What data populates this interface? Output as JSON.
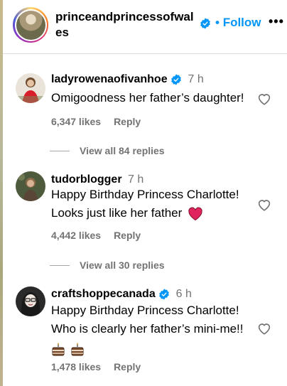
{
  "header": {
    "username": "princeandprincessofwales",
    "follow_label": "Follow",
    "more_label": "•••"
  },
  "comments": [
    {
      "username": "ladyrowenaofivanhoe",
      "time": "7 h",
      "text": "Omigoodness her father’s daughter!",
      "likes": "6,347 likes",
      "reply_label": "Reply",
      "view_replies": "View all 84 replies"
    },
    {
      "username": "tudorblogger",
      "time": "7 h",
      "text_line1": "Happy Birthday Princess Charlotte!",
      "text_line2": "Looks just like her father",
      "likes": "4,442 likes",
      "reply_label": "Reply",
      "view_replies": "View all 30 replies"
    },
    {
      "username": "craftshoppecanada",
      "time": "6 h",
      "text_line1": "Happy Birthday Princess Charlotte!",
      "text_line2": "Who is clearly her father’s mini-me!!",
      "likes": "1,478 likes",
      "reply_label": "Reply"
    }
  ],
  "colors": {
    "accent": "#0095f6",
    "verified": "#0095f6",
    "muted": "#737373",
    "heart_emoji": "#e0245e"
  },
  "icons": [
    "verified-badge-icon",
    "heart-outline-icon",
    "red-heart-emoji-icon",
    "cake-emoji-icon",
    "more-dots-icon"
  ]
}
